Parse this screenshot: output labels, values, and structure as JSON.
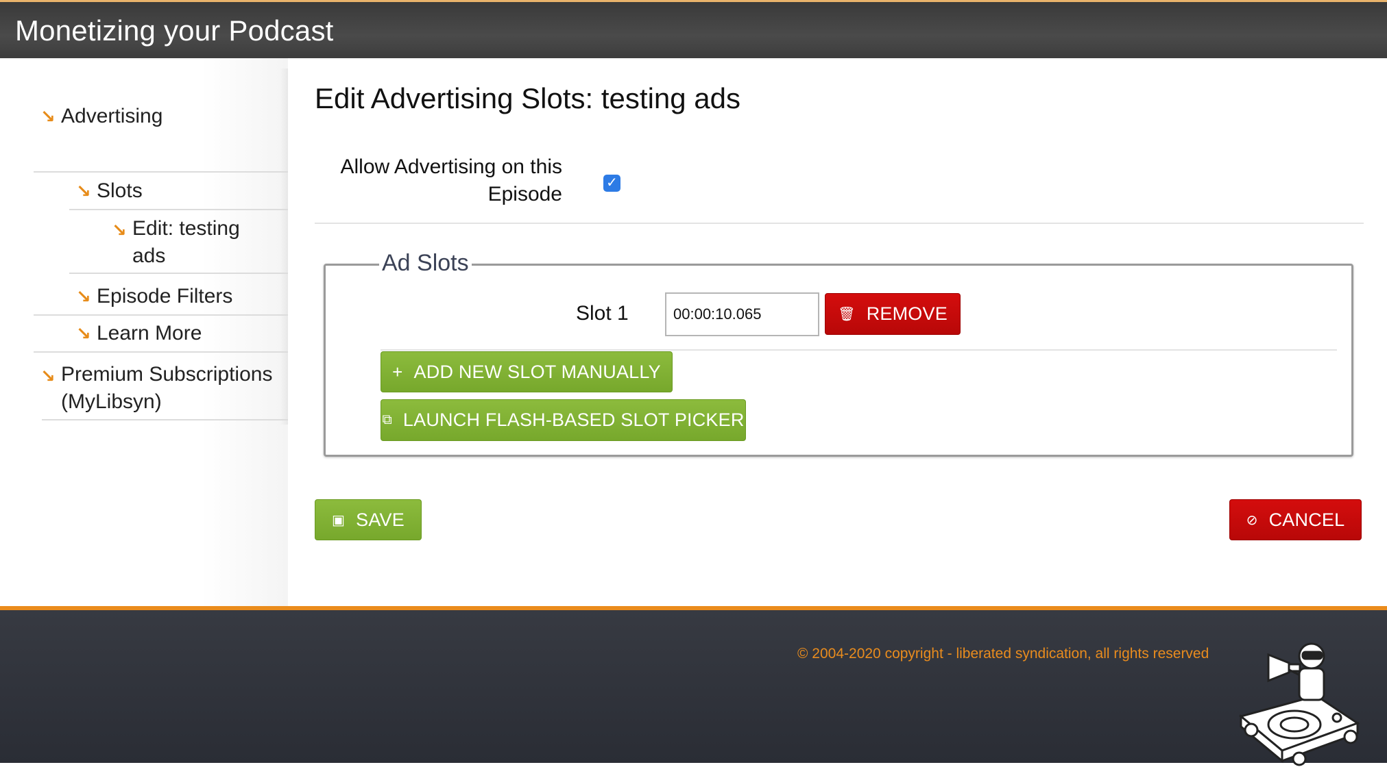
{
  "header": {
    "title": "Monetizing your Podcast"
  },
  "sidebar": {
    "items": [
      {
        "label": "Advertising"
      },
      {
        "label": "Slots"
      },
      {
        "label_line1": "Edit: testing",
        "label_line2": "ads"
      },
      {
        "label": "Episode Filters"
      },
      {
        "label": "Learn More"
      },
      {
        "label_line1": "Premium Subscriptions",
        "label_line2": "(MyLibsyn)"
      }
    ],
    "arrow_icon": "arrow-down-right-icon"
  },
  "main": {
    "title": "Edit Advertising Slots: testing ads",
    "allow_label_line1": "Allow Advertising on this",
    "allow_label_line2": "Episode",
    "allow_checked": true,
    "ad_slots": {
      "legend": "Ad Slots",
      "slots": [
        {
          "label": "Slot 1",
          "value": "00:00:10.065",
          "remove_label": "REMOVE"
        }
      ],
      "add_button": "ADD NEW SLOT MANUALLY",
      "launch_button": "LAUNCH FLASH-BASED SLOT PICKER"
    },
    "save_label": "SAVE",
    "cancel_label": "CANCEL"
  },
  "footer": {
    "copyright": "© 2004-2020 copyright - liberated syndication, all rights reserved"
  },
  "colors": {
    "accent_orange": "#e98c1e",
    "button_green": "#7fb032",
    "button_red": "#c90a0a",
    "checkbox_blue": "#2d7be5"
  }
}
